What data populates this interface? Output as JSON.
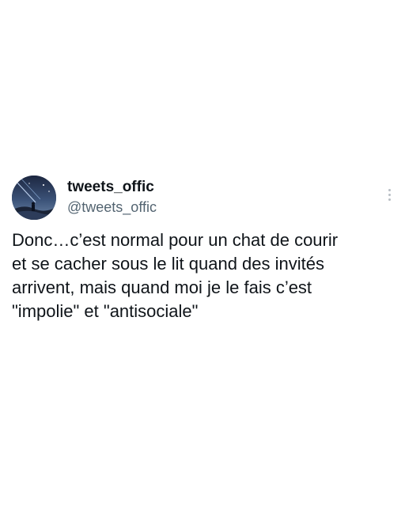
{
  "tweet": {
    "author": {
      "display_name": "tweets_offic",
      "handle": "@tweets_offic",
      "avatar_icon": "night-sky-avatar"
    },
    "more_icon": "more-vertical-icon",
    "text_lines": [
      "Donc…c’est normal pour un chat de courir",
      "et se cacher sous le lit quand des invités",
      "arrivent, mais quand moi je le fais c’est",
      "\"impolie\" et \"antisociale\""
    ]
  }
}
